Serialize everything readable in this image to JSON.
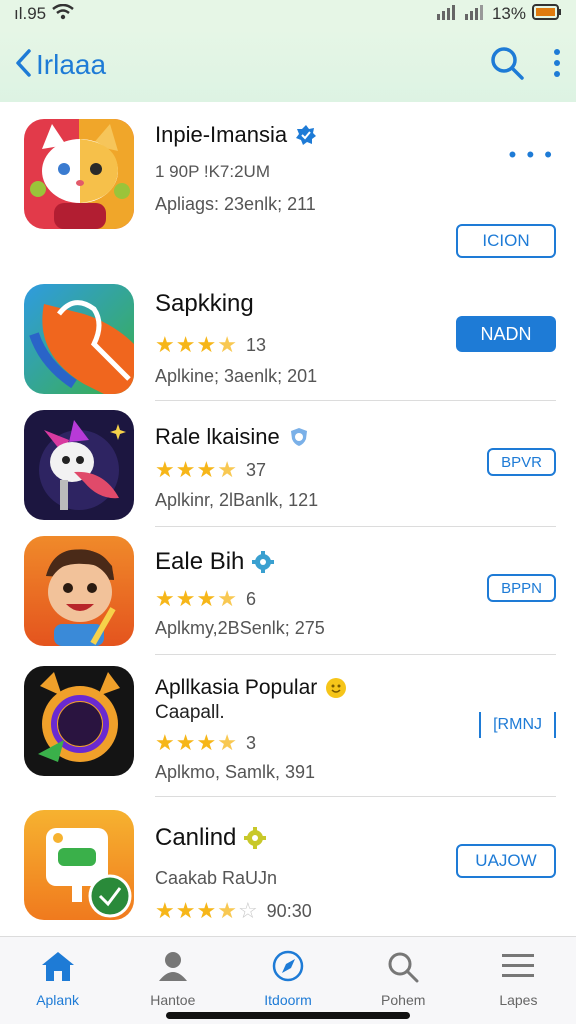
{
  "status": {
    "time": "ıl.95",
    "battery": "13%"
  },
  "header": {
    "title": "Irlaaa"
  },
  "apps": [
    {
      "name": "Inpie-Imansia",
      "line2": "1 90P  !K7:2UM",
      "line3": "Apliags: 23enlk; 211",
      "button": "ICION",
      "more": "• • •"
    },
    {
      "name": "Sapkking",
      "rating_count": "13",
      "stars": [
        1,
        1,
        1,
        0.5,
        0
      ],
      "line3": "Aplkine; 3aenlk; 201",
      "button": "NADN"
    },
    {
      "name": "Rale lkaisine",
      "rating_count": "37",
      "stars": [
        1,
        1,
        1,
        0.5,
        0
      ],
      "line3": "Aplkinr, 2lBanlk, 121",
      "button": "BPVR"
    },
    {
      "name": "Eale Bih",
      "rating_count": "6",
      "stars": [
        1,
        1,
        1,
        0.5,
        0
      ],
      "line3": "Aplkmy,2BSenlk; 275",
      "button": "BPPN"
    },
    {
      "name": "Apllkasia Popular",
      "line2": "Caapall.",
      "rating_count": "3",
      "stars": [
        1,
        1,
        1,
        0.5,
        0
      ],
      "line3": "Aplkmo, Samlk, 391",
      "button": "[RMNJ"
    },
    {
      "name": "Canlind",
      "line2": "Caakab RaUJn",
      "rating_count": "90:30",
      "stars": [
        1,
        1,
        1,
        0.5,
        0
      ],
      "button": "UAJOW"
    }
  ],
  "tabs": [
    {
      "label": "Aplank",
      "icon": "home-icon"
    },
    {
      "label": "Hantoe",
      "icon": "person-icon"
    },
    {
      "label": "Itdoorm",
      "icon": "compass-icon"
    },
    {
      "label": "Pohem",
      "icon": "search-icon"
    },
    {
      "label": "Lapes",
      "icon": "menu-icon"
    }
  ],
  "colors": {
    "accent": "#1e7bd6",
    "header_bg": "#e6f6e6",
    "star": "#f6b619"
  }
}
